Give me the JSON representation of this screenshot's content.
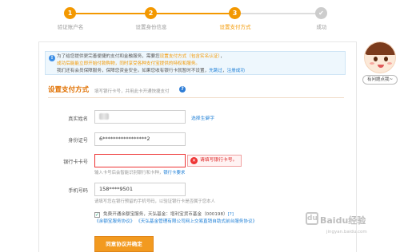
{
  "steps": [
    {
      "num": "1",
      "label": "验证账户名"
    },
    {
      "num": "2",
      "label": "设置身份信息"
    },
    {
      "num": "3",
      "label": "设置支付方式"
    },
    {
      "num": "✔",
      "label": "成功"
    }
  ],
  "notice": {
    "line1_a": "为了给您提供更完善便捷的支付和金融服务，需要您",
    "line1_link": "设置支付方式（包含实名认证）",
    "line1_b": "，",
    "line2": "成功后能能立即开始付款购物，同时享受各种支付宝提供的特权和服务。",
    "line3_a": "我们还有会员保障服务，保障您资金安全。如果您收有银行卡就暂时不设置，",
    "line3_link1": "先跳过",
    "line3_sep": "，",
    "line3_link2": "注册成功"
  },
  "section": {
    "title": "设置支付方式",
    "hint": "填写银行卡号，并用此卡开通快捷支付",
    "help": "?"
  },
  "form": {
    "real_name_label": "真实姓名",
    "select_char_link": "选择生僻字",
    "id_label": "身份证号",
    "id_value": "6*****************2",
    "card_label": "银行卡卡号",
    "card_error": "请填写银行卡号。",
    "card_hint_a": "输入卡号后会智能识别银行和卡种，",
    "card_hint_link": "银行卡要求",
    "phone_label": "手机号码",
    "phone_value": "158****9501",
    "phone_hint": "请填写您在银行预留的手机号码，以验证银行卡是否属于您本人",
    "agree_line1": "免费开通余额宝服务，天弘基金：增利宝货币基金（000198）",
    "agree_line1_q": "[?]",
    "agree_link1": "《余额宝服务协议》",
    "agree_link2": "《天弘基金管理有限公司网上交易直销自助式前台服务协议》",
    "submit_label": "同意协议并确定"
  },
  "side": {
    "button_label": "有问题点我~"
  },
  "watermark": {
    "title": "Baidu经验",
    "url": "jingyan.baidu.com"
  },
  "colors": {
    "step_done": "#f39800",
    "step_pending": "#cccccc",
    "accent": "#f29a20",
    "link": "#1e7fd6",
    "error": "#e33333"
  }
}
